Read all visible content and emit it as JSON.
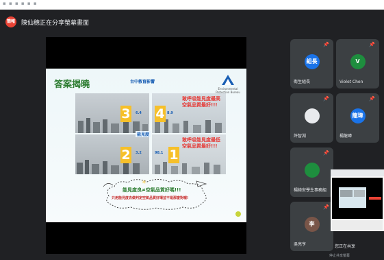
{
  "top_strip": {
    "text": "▪ ▪ ▪ ▪ ▪ ▪"
  },
  "presentation_bar": {
    "badge": "簡報",
    "title": "陳仙穗正在分享螢幕畫面"
  },
  "slide": {
    "title": "答案揭曉",
    "tag": "台中教育影響",
    "org_caption": "Environmental Protection Bureau",
    "center_label": "能見度",
    "photos": [
      {
        "number": "3",
        "aqi": "6.4"
      },
      {
        "number": "4",
        "aqi": "8.9",
        "caption": "敢呼吸能見度最高空氣品質最好!!!"
      },
      {
        "number": "2",
        "aqi": "3.2"
      },
      {
        "number": "1",
        "aqi": "98.1",
        "caption": "敢呼吸能見度最低空氣品質最好!!!"
      }
    ],
    "cloud_line1": "能見度良≠空氣品質好嗎!!!",
    "cloud_line2": "只用能見度去做判定空氣品質好壞並不是那麼對喔!"
  },
  "participants": [
    {
      "initials": "組長",
      "name": "衛生組長",
      "color": "#1a73e8"
    },
    {
      "initials": "V",
      "name": "Violet Chen",
      "color": "#1e8e3e"
    },
    {
      "initials": "",
      "name": "許智淵",
      "color": "#e8eaed"
    },
    {
      "initials": "龍瑋",
      "name": "楊龍瑋",
      "color": "#1a73e8"
    },
    {
      "initials": "",
      "name": "楊綺安學生事務組",
      "color": "#1e8e3e"
    },
    {
      "initials": "李",
      "name": "吳亮亨",
      "color": "#795548"
    }
  ],
  "share_preview": {
    "label": "您正在共享",
    "sub": "停止共享螢幕"
  }
}
